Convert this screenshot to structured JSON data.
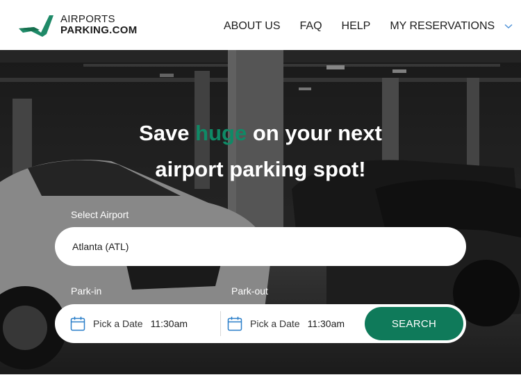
{
  "brand": {
    "line1": "AIRPORTS",
    "line2": "PARKING.COM",
    "logo_icon": "plane-arrow-logo",
    "color": "#1f8a68"
  },
  "nav": {
    "items": [
      {
        "label": "ABOUT US"
      },
      {
        "label": "FAQ"
      },
      {
        "label": "HELP"
      },
      {
        "label": "MY RESERVATIONS"
      }
    ],
    "dropdown_icon": "chevron-down-icon"
  },
  "hero": {
    "headline_pre": "Save ",
    "headline_accent": "huge",
    "headline_post": " on your next",
    "headline_line2": "airport parking spot!",
    "accent_color": "#0f8a66",
    "background": "parking-garage-photo"
  },
  "search": {
    "airport_label": "Select Airport",
    "airport_value": "Atlanta (ATL)",
    "parkin_label": "Park-in",
    "parkout_label": "Park-out",
    "parkin_date": "Pick a Date",
    "parkin_time": "11:30am",
    "parkout_date": "Pick a Date",
    "parkout_time": "11:30am",
    "calendar_icon": "calendar-icon",
    "button_label": "SEARCH",
    "button_color": "#0f7a5a"
  }
}
